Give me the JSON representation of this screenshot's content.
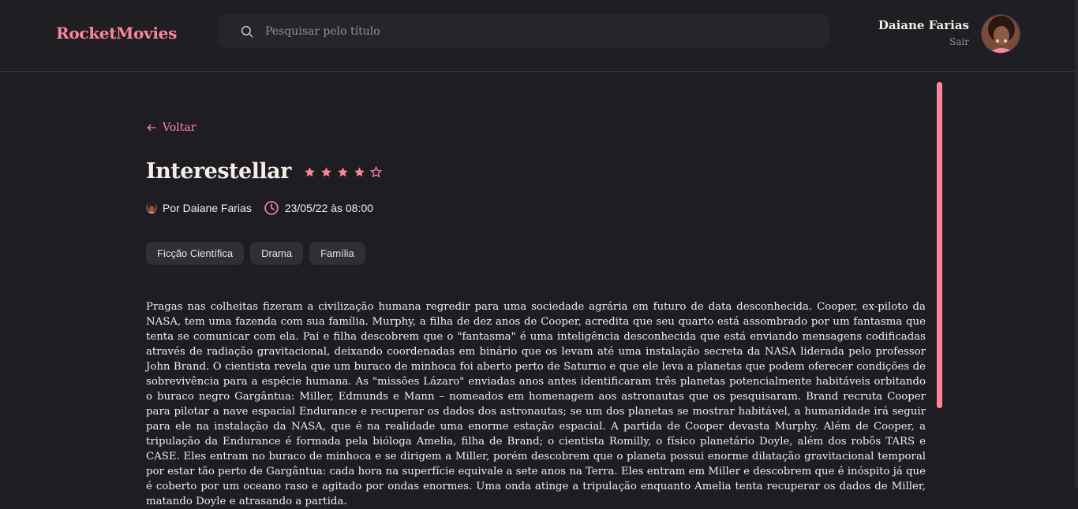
{
  "header": {
    "brand": "RocketMovies",
    "search": {
      "placeholder": "Pesquisar pelo título",
      "value": ""
    },
    "user": {
      "name": "Daiane Farias",
      "signout_label": "Sair"
    }
  },
  "page": {
    "back_label": "Voltar",
    "movie": {
      "title": "Interestellar",
      "rating": 4,
      "rating_max": 5,
      "author": "Por Daiane Farias",
      "datetime": "23/05/22 às 08:00",
      "tags": [
        "Ficção Científica",
        "Drama",
        "Família"
      ],
      "synopsis": "Pragas nas colheitas fizeram a civilização humana regredir para uma sociedade agrária em futuro de data desconhecida. Cooper, ex-piloto da NASA, tem uma fazenda com sua família. Murphy, a filha de dez anos de Cooper, acredita que seu quarto está assombrado por um fantasma que tenta se comunicar com ela. Pai e filha descobrem que o \"fantasma\" é uma inteligência desconhecida que está enviando mensagens codificadas através de radiação gravitacional, deixando coordenadas em binário que os levam até uma instalação secreta da NASA liderada pelo professor John Brand. O cientista revela que um buraco de minhoca foi aberto perto de Saturno e que ele leva a planetas que podem oferecer condições de sobrevivência para a espécie humana. As \"missões Lázaro\" enviadas anos antes identificaram três planetas potencialmente habitáveis orbitando o buraco negro Gargântua: Miller, Edmunds e Mann – nomeados em homenagem aos astronautas que os pesquisaram. Brand recruta Cooper para pilotar a nave espacial Endurance e recuperar os dados dos astronautas; se um dos planetas se mostrar habitável, a humanidade irá seguir para ele na instalação da NASA, que é na realidade uma enorme estação espacial. A partida de Cooper devasta Murphy. Além de Cooper, a tripulação da Endurance é formada pela bióloga Amelia, filha de Brand; o cientista Romilly, o físico planetário Doyle, além dos robôs TARS e CASE. Eles entram no buraco de minhoca e se dirigem a Miller, porém descobrem que o planeta possui enorme dilatação gravitacional temporal por estar tão perto de Gargântua: cada hora na superfície equivale a sete anos na Terra. Eles entram em Miller e descobrem que é inóspito já que é coberto por um oceano raso e agitado por ondas enormes. Uma onda atinge a tripulação enquanto Amelia tenta recuperar os dados de Miller, matando Doyle e atrasando a partida."
    }
  },
  "colors": {
    "accent": "#ff859b",
    "background": "#1f1d24",
    "tag_bg": "#312e38"
  }
}
